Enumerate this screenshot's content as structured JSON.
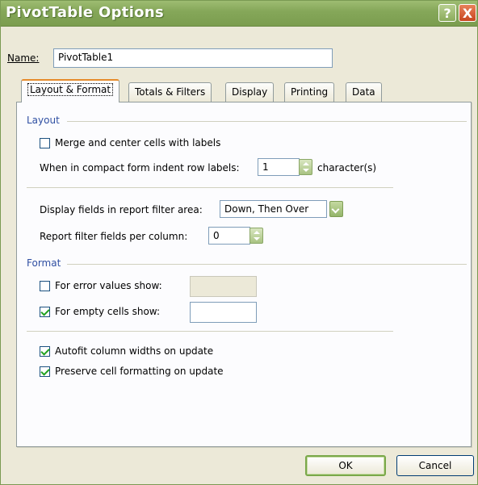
{
  "window": {
    "title": "PivotTable Options",
    "help": "?",
    "close": "X"
  },
  "name": {
    "label": "Name:",
    "value": "PivotTable1"
  },
  "tabs": [
    {
      "label": "Layout & Format",
      "active": true
    },
    {
      "label": "Totals & Filters"
    },
    {
      "label": "Display"
    },
    {
      "label": "Printing"
    },
    {
      "label": "Data"
    }
  ],
  "layout": {
    "group": "Layout",
    "merge_label": "Merge and center cells with labels",
    "merge_checked": false,
    "indent_label": "When in compact form indent row labels:",
    "indent_value": "1",
    "indent_unit": "character(s)",
    "filter_area_label": "Display fields in report filter area:",
    "filter_area_value": "Down, Then Over",
    "filter_per_col_label": "Report filter fields per column:",
    "filter_per_col_value": "0"
  },
  "format": {
    "group": "Format",
    "error_label": "For error values show:",
    "error_checked": false,
    "error_value": "",
    "empty_label": "For empty cells show:",
    "empty_checked": true,
    "empty_value": "",
    "autofit_label": "Autofit column widths on update",
    "autofit_checked": true,
    "preserve_label": "Preserve cell formatting on update",
    "preserve_checked": true
  },
  "buttons": {
    "ok": "OK",
    "cancel": "Cancel"
  },
  "colors": {
    "titlebar": "#86a85a",
    "group_label": "#2f4fa2",
    "active_tab_accent": "#e68b2c"
  }
}
